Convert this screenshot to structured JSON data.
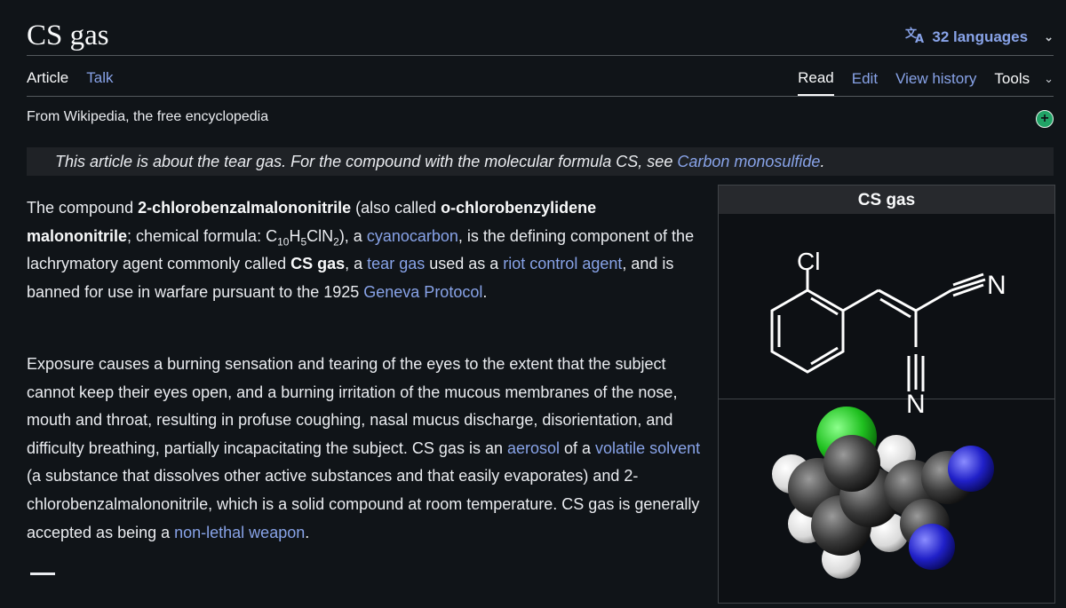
{
  "page": {
    "title": "CS gas",
    "languages_label": "32 languages",
    "tabs_left": [
      "Article",
      "Talk"
    ],
    "tabs_right": [
      "Read",
      "Edit",
      "View history",
      "Tools"
    ],
    "tagline": "From Wikipedia, the free encyclopedia",
    "hatnote_text": "This article is about the tear gas. For the compound with the molecular formula CS, see ",
    "hatnote_link": "Carbon monosulfide",
    "hatnote_end": "."
  },
  "paragraph1": {
    "t1": "The compound ",
    "b1": "2-chlorobenzalmalononitrile",
    "t2": " (also called ",
    "b2": "o-chlorobenzylidene malononitrile",
    "t3": "; chemical formula: C",
    "sub1": "10",
    "t4": "H",
    "sub2": "5",
    "t5": "ClN",
    "sub3": "2",
    "t6": "), a ",
    "link1": "cyanocarbon",
    "t7": ", is the defining component of the lachrymatory agent commonly called ",
    "b3": "CS gas",
    "t8": ", a ",
    "link2": "tear gas",
    "t9": " used as a ",
    "link3": "riot control agent",
    "t10": ", and is banned for use in warfare pursuant to the 1925 ",
    "link4": "Geneva Protocol",
    "t11": "."
  },
  "paragraph2": {
    "t1": "Exposure causes a burning sensation and tearing of the eyes to the extent that the subject cannot keep their eyes open, and a burning irritation of the mucous membranes of the nose, mouth and throat, resulting in profuse coughing, nasal mucus discharge, disorientation, and difficulty breathing, partially incapacitating the subject. CS gas is an ",
    "link1": "aerosol",
    "t2": " of a ",
    "link2": "volatile solvent",
    "t3": " (a substance that dissolves other active substances and that easily evaporates) and 2-chlorobenzalmalononitrile, which is a solid compound at room temperature. CS gas is generally accepted as being a ",
    "link3": "non-lethal weapon",
    "t4": "."
  },
  "infobox": {
    "title": "CS gas",
    "structure_labels": {
      "cl": "Cl",
      "n1": "N",
      "n2": "N"
    }
  },
  "colors": {
    "background": "#101418",
    "link": "#88a3e8",
    "text": "#eaecf0",
    "add_icon": "#21a366"
  }
}
